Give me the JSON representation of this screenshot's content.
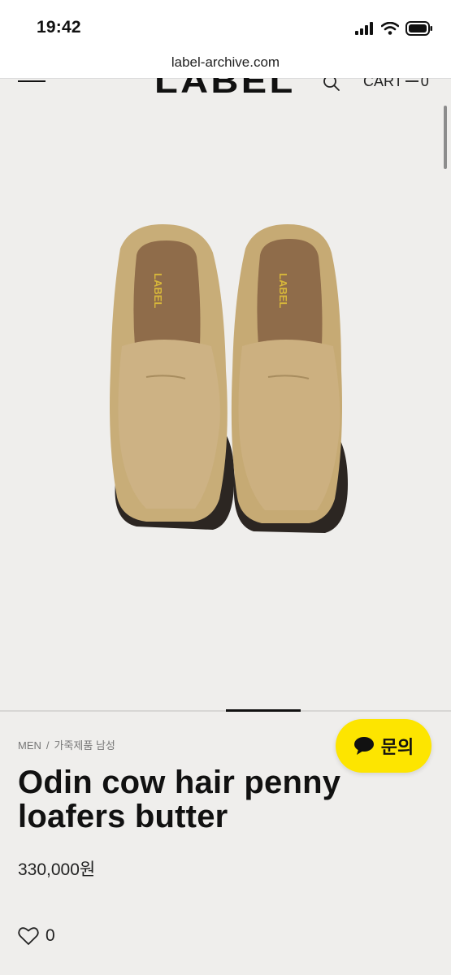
{
  "status": {
    "time": "19:42"
  },
  "browser": {
    "url": "label-archive.com"
  },
  "header": {
    "logo": "LABEL",
    "cart_label": "CART",
    "cart_count": "0"
  },
  "product": {
    "image_logo": "LABEL",
    "breadcrumb": [
      "MEN",
      "가죽제품 남성"
    ],
    "title": "Odin cow hair penny loafers butter",
    "price": "330,000원",
    "wishlist_count": "0"
  },
  "inquiry": {
    "label": "문의"
  },
  "icons": [
    "signal-icon",
    "wifi-icon",
    "battery-icon",
    "menu-icon",
    "search-icon",
    "heart-icon",
    "chat-bubble-icon"
  ],
  "colors": {
    "accent": "#fde500",
    "background": "#efeeec"
  }
}
